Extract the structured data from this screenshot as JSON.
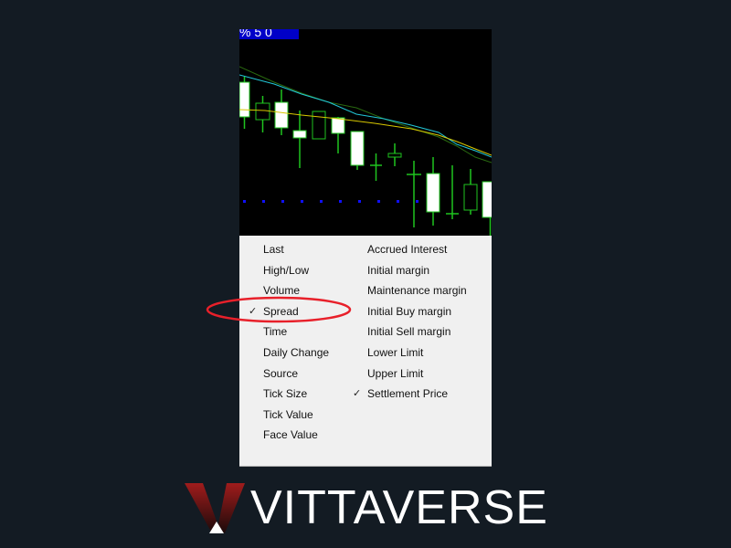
{
  "chart_header": "% 5 0",
  "menu": {
    "left": [
      {
        "label": "Last",
        "checked": false
      },
      {
        "label": "High/Low",
        "checked": false
      },
      {
        "label": "Volume",
        "checked": false
      },
      {
        "label": "Spread",
        "checked": true
      },
      {
        "label": "Time",
        "checked": false
      },
      {
        "label": "Daily Change",
        "checked": false
      },
      {
        "label": "Source",
        "checked": false
      },
      {
        "label": "Tick Size",
        "checked": false
      },
      {
        "label": "Tick Value",
        "checked": false
      },
      {
        "label": "Face Value",
        "checked": false
      }
    ],
    "right": [
      {
        "label": "Accrued Interest",
        "checked": false
      },
      {
        "label": "Initial margin",
        "checked": false
      },
      {
        "label": "Maintenance margin",
        "checked": false
      },
      {
        "label": "Initial Buy margin",
        "checked": false
      },
      {
        "label": "Initial Sell margin",
        "checked": false
      },
      {
        "label": "Lower Limit",
        "checked": false
      },
      {
        "label": "Upper Limit",
        "checked": false
      },
      {
        "label": "Settlement Price",
        "checked": true
      }
    ],
    "check_glyph": "✓"
  },
  "highlight_color": "#e8202a",
  "brand": {
    "name": "VITTAVERSE",
    "accent": "#a01c1c"
  }
}
